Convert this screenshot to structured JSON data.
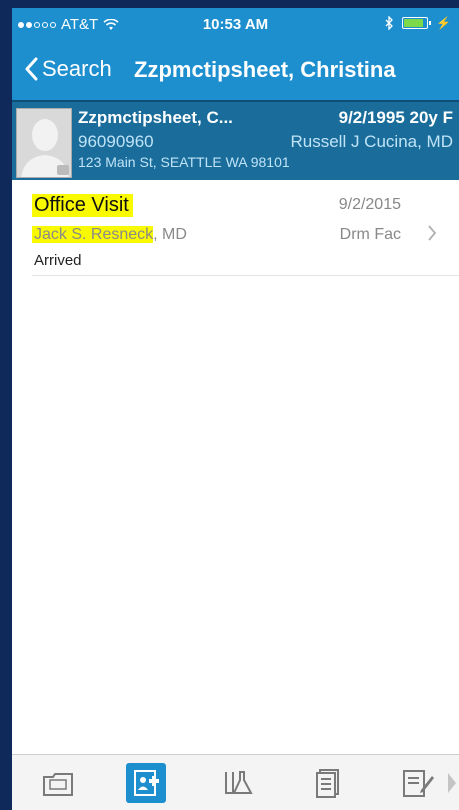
{
  "status_bar": {
    "carrier": "AT&T",
    "time": "10:53 AM",
    "signal_bars_filled": 2,
    "signal_bars_total": 5
  },
  "nav": {
    "back_label": "Search",
    "title": "Zzpmctipsheet, Christina"
  },
  "patient": {
    "name": "Zzpmctipsheet, C...",
    "dob_age_sex": "9/2/1995 20y F",
    "mrn": "96090960",
    "physician": "Russell J Cucina, MD",
    "address": "123 Main St, SEATTLE WA 98101"
  },
  "visit": {
    "type": "Office Visit",
    "date": "9/2/2015",
    "provider_name": "Jack S. Resneck",
    "provider_suffix": ", MD",
    "facility": "Drm Fac",
    "status": "Arrived"
  },
  "tabbar": {
    "tabs": [
      {
        "icon": "folder-icon"
      },
      {
        "icon": "patient-chart-icon",
        "active": true
      },
      {
        "icon": "lab-flask-icon"
      },
      {
        "icon": "document-list-icon"
      },
      {
        "icon": "note-edit-icon"
      }
    ]
  },
  "colors": {
    "header_blue": "#1d8fcf",
    "patient_bar": "#1a6d9b",
    "highlight": "#f9f900"
  }
}
